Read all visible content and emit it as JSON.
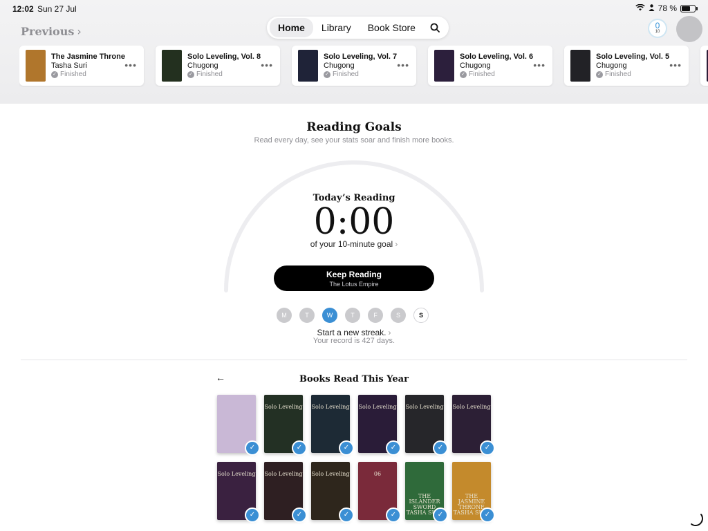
{
  "status_bar": {
    "time": "12:02",
    "date": "Sun 27 Jul",
    "battery": "78 %",
    "battery_level": 0.78
  },
  "header": {
    "previous_label": "Previous",
    "tabs": [
      {
        "label": "Home",
        "active": true
      },
      {
        "label": "Library",
        "active": false
      },
      {
        "label": "Book Store",
        "active": false
      }
    ],
    "goal_ring": {
      "value": "0",
      "goal": "10"
    }
  },
  "previous_books": [
    {
      "title": "The Jasmine Throne",
      "author": "Tasha Suri",
      "status": "Finished",
      "cover_color": "#b0762c"
    },
    {
      "title": "Solo Leveling, Vol. 8",
      "author": "Chugong",
      "status": "Finished",
      "cover_color": "#23301f"
    },
    {
      "title": "Solo Leveling, Vol. 7",
      "author": "Chugong",
      "status": "Finished",
      "cover_color": "#1f2338"
    },
    {
      "title": "Solo Leveling, Vol. 6",
      "author": "Chugong",
      "status": "Finished",
      "cover_color": "#2c1f3c"
    },
    {
      "title": "Solo Leveling, Vol. 5",
      "author": "Chugong",
      "status": "Finished",
      "cover_color": "#222226"
    }
  ],
  "reading_goals": {
    "title": "Reading Goals",
    "subtitle": "Read every day, see your stats soar and finish more books.",
    "today_label": "Today’s Reading",
    "time": "0:00",
    "goal_text": "of your 10-minute goal",
    "button_label": "Keep Reading",
    "button_sub": "The Lotus Empire",
    "days": [
      "M",
      "T",
      "W",
      "T",
      "F",
      "S",
      "S"
    ],
    "today_index": 2,
    "streak_text": "Start a new streak.",
    "record_text": "Your record is 427 days."
  },
  "books_read": {
    "title": "Books Read This Year",
    "books": [
      {
        "label": "",
        "color": "#c9b8d6"
      },
      {
        "label": "Solo Leveling",
        "color": "#233024"
      },
      {
        "label": "Solo Leveling",
        "color": "#1d2a35"
      },
      {
        "label": "Solo Leveling",
        "color": "#2a1c38"
      },
      {
        "label": "Solo Leveling",
        "color": "#26262a"
      },
      {
        "label": "Solo Leveling",
        "color": "#2c1f35"
      },
      {
        "label": "Solo Leveling",
        "color": "#3a2140"
      },
      {
        "label": "Solo Leveling",
        "color": "#2e1f22"
      },
      {
        "label": "Solo Leveling",
        "color": "#2e261c"
      },
      {
        "label": "06",
        "color": "#7a2a3a"
      },
      {
        "label": "THE ISLANDER SWORD TASHA SURI",
        "color": "#2f6a3a"
      },
      {
        "label": "THE JASMINE THRONE TASHA SURI",
        "color": "#c48a2c"
      }
    ]
  },
  "colors": {
    "accent": "#3b8fd4",
    "button": "#000000"
  }
}
